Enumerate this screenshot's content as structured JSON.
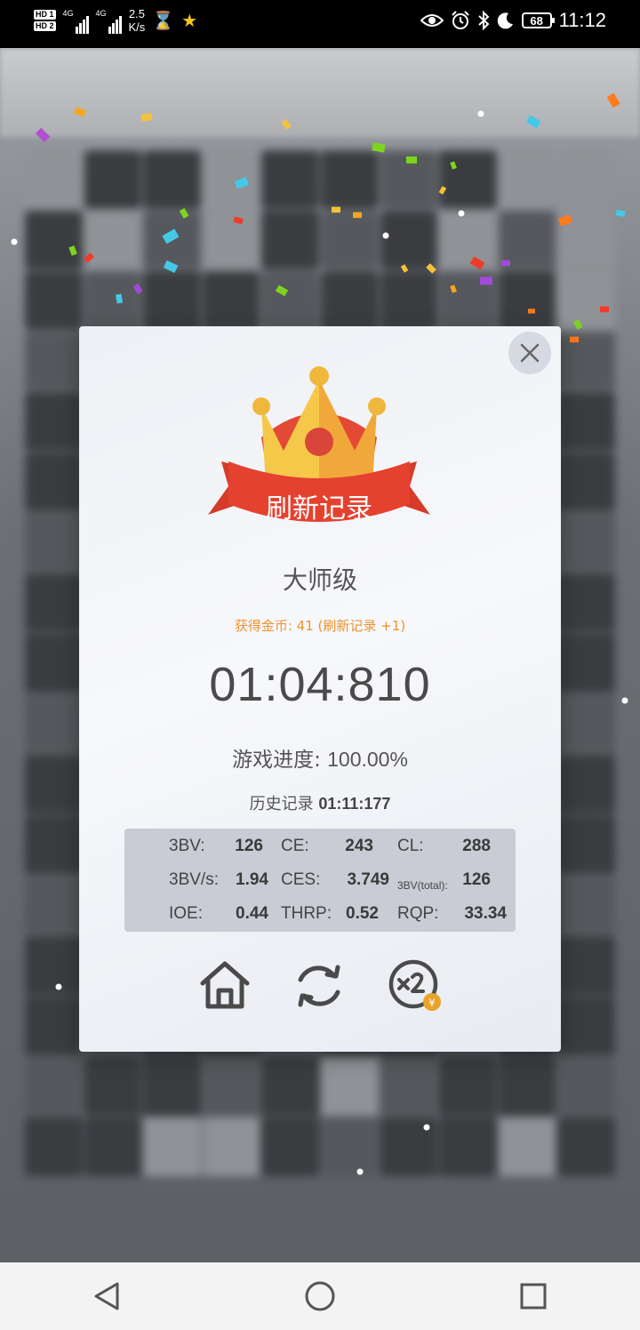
{
  "status_bar": {
    "hd1": "HD 1",
    "hd2": "HD 2",
    "sig1_label": "4G",
    "sig2_label": "4G",
    "speed_value": "2.5",
    "speed_unit": "K/s",
    "hourglass_icon": "hourglass-icon",
    "star_icon": "star-icon",
    "battery": "68",
    "time": "11:12"
  },
  "dialog": {
    "banner": "刷新记录",
    "level": "大师级",
    "coins_text": "获得金币: 41 (刷新记录 +1)",
    "time": "01:04:810",
    "progress_label": "游戏进度:",
    "progress_value": "100.00%",
    "history_label": "历史记录",
    "history_value": "01:11:177",
    "stats": {
      "r1": {
        "l1": "3BV:",
        "v1": "126",
        "l2": "CE:",
        "v2": "243",
        "l3": "CL:",
        "v3": "288"
      },
      "r2": {
        "l1": "3BV/s:",
        "v1": "1.94",
        "l2": "CES:",
        "v2": "3.749",
        "l3": "3BV(total):",
        "v3": "126"
      },
      "r3": {
        "l1": "IOE:",
        "v1": "0.44",
        "l2": "THRP:",
        "v2": "0.52",
        "l3": "RQP:",
        "v3": "33.34"
      }
    }
  },
  "colors": {
    "accent_orange": "#f0922e",
    "crown_red": "#e24a35",
    "crown_yellow": "#f5c84a"
  }
}
